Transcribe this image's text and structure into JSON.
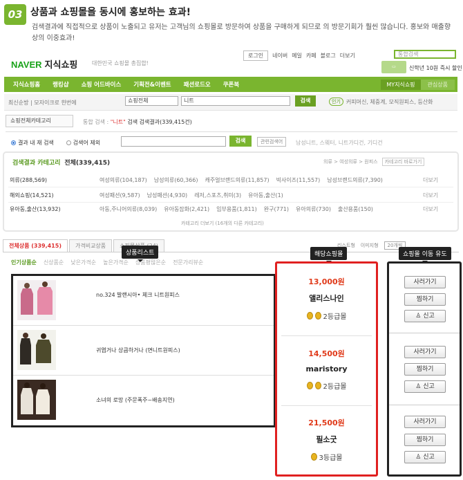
{
  "header": {
    "badge": "03",
    "title": "상품과 쇼핑몰을 동시에 홍보하는 효과!",
    "desc": "검색결과에 직접적으로 상품이 노출되고 유저는 고객님의 쇼핑몰로 방문하여 상품을 구매하게 되므로 의 방문기회가 훨씬 많습니다. 홍보와 매출향상의 이중효과!"
  },
  "naver": {
    "logo": "NAVER",
    "logo_sub": "지식쇼핑",
    "tagline": "대한민국 쇼핑몰 총집합!",
    "toplinks": [
      "로그인",
      "네이버",
      "메일",
      "카페",
      "블로그",
      "더보기"
    ],
    "top_search_placeholder": "통합검색",
    "promo_text": "신학년 10원 즉시 할인",
    "promo_strong": "10원 즉시 할인"
  },
  "gnav": {
    "items": [
      "지식쇼핑홈",
      "랭킹샵",
      "쇼핑 어드바이스",
      "기획전&이벤트",
      "패션로드오",
      "쿠폰북"
    ],
    "my": "MY지식쇼핑",
    "myb": "관심상품"
  },
  "search": {
    "recent": "최신순방 | 모자이크로 한번에",
    "category": "쇼핑전체",
    "query": "니트",
    "button": "검색",
    "popular_label": "인기",
    "popular_words": "커피머신, 체중계, 모직원피스, 등산화"
  },
  "category_bar": {
    "select": "쇼핑전체카테고리",
    "crumb_pre": "통합 검색 : ",
    "crumb_query": "\"니트\"",
    "crumb_post": " 검색 검색결과(339,415건)"
  },
  "refine": {
    "opt1": "결과 내 재 검색",
    "opt2": "검색어 제외",
    "button": "검색",
    "related": "관련검색어",
    "related_words": "남성니트, 스웨터, 니트가디건, 기디건"
  },
  "catbox": {
    "title": "검색결과 카테고리",
    "total": "전체(339,415)",
    "right1": "의류 > 여성의류 > 원피스",
    "right2": "카테고리 바로가기",
    "rows": [
      {
        "head": "의류(288,569)",
        "items": [
          "여성의류(104,187)",
          "남성의류(60,366)",
          "캐주얼브랜드의류(11,857)",
          "빅사이즈(11,557)",
          "남성브랜드의류(7,390)"
        ],
        "more": "더보기"
      },
      {
        "head": "해외쇼핑(14,521)",
        "items": [
          "여성패션(9,587)",
          "남성패션(4,930)",
          "레저,스포츠,취미(3)",
          "유아동,출산(1)"
        ],
        "more": "더보기"
      },
      {
        "head": "유아동,출산(13,932)",
        "items": [
          "아동,주니어의류(8,039)",
          "유아동잡화(2,421)",
          "임부용품(1,811)",
          "완구(771)",
          "유아의류(730)",
          "출산용품(150)"
        ],
        "more": "더보기"
      }
    ],
    "foot": "카테고리 더보기 (16개의 다른 카테고리)"
  },
  "tabs": {
    "items": [
      "전체상품 (339,415)",
      "가격비교상품",
      "쇼핑몰상품 (24)"
    ],
    "sub": [
      "인기상품순",
      "신상품순",
      "낮은가격순",
      "높은가격순",
      "상품평많은순",
      "전문가리뷰순"
    ],
    "view": [
      "리스트형",
      "이미지형",
      "20개씩"
    ]
  },
  "callouts": {
    "product_list": "상품리스트",
    "seller": "해당쇼핑몰",
    "visit": "쇼핑몰 이동 유도"
  },
  "products": [
    {
      "name": "no.324 발랜시아• 체크 니트원피스"
    },
    {
      "name": "귀엽거나 상큼하거나 (면니트원피스)"
    },
    {
      "name": "소녀의 로망 (주문폭주~배송지연)"
    }
  ],
  "sellers": [
    {
      "price": "13,000원",
      "mall": "앨리스나인",
      "grade": "2등급몰"
    },
    {
      "price": "14,500원",
      "mall": "maristory",
      "grade": "2등급몰"
    },
    {
      "price": "21,500원",
      "mall": "필소굿",
      "grade": "3등급몰"
    }
  ],
  "actions": {
    "buy": "사러가기",
    "wish": "찜하기",
    "report": "신고"
  },
  "colors": {
    "brand_green": "#7ab52f",
    "price_red": "#e03a1a",
    "highlight_red": "#e02020"
  }
}
